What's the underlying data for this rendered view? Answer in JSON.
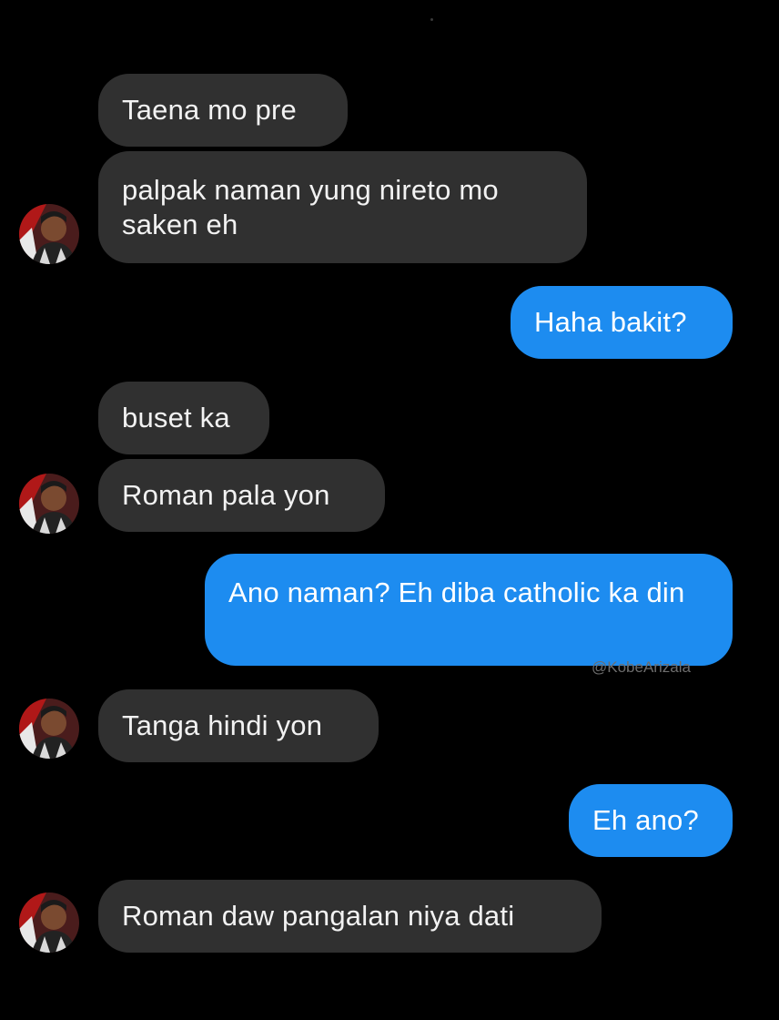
{
  "conversation": {
    "messages": [
      {
        "sender": "contact",
        "text": "Taena mo pre"
      },
      {
        "sender": "contact",
        "text": "palpak naman yung nireto mo saken eh"
      },
      {
        "sender": "me",
        "text": "Haha bakit?"
      },
      {
        "sender": "contact",
        "text": "buset ka"
      },
      {
        "sender": "contact",
        "text": "Roman pala yon"
      },
      {
        "sender": "me",
        "text": "Ano naman? Eh diba catholic ka din"
      },
      {
        "sender": "contact",
        "text": "Tanga hindi yon"
      },
      {
        "sender": "me",
        "text": "Eh ano?"
      },
      {
        "sender": "contact",
        "text": "Roman daw pangalan niya dati"
      }
    ]
  },
  "watermark": "@KobeArizala",
  "icons": {
    "contact_avatar": "contact-avatar-photo"
  },
  "colors": {
    "background": "#000000",
    "incoming_bubble": "#303030",
    "outgoing_bubble": "#1d8cf0",
    "text": "#ffffff"
  }
}
